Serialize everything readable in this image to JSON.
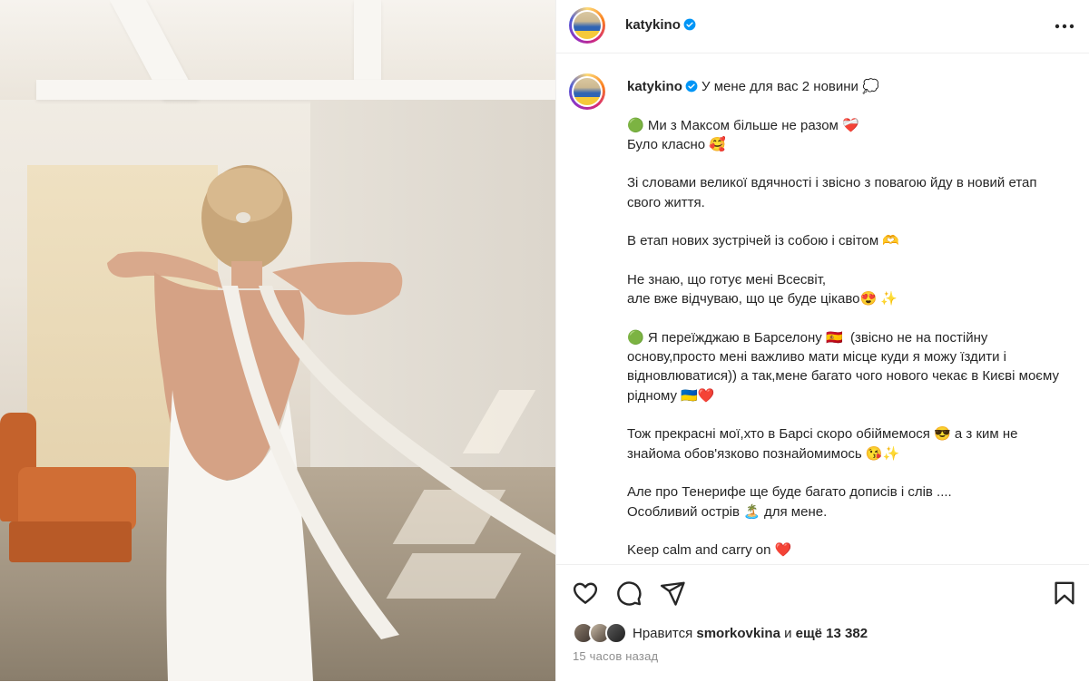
{
  "post": {
    "username": "katykino",
    "caption_lines": [
      "У мене для вас 2 новини 💭",
      "",
      "🟢 Ми з Максом більше не разом ❤️‍🩹",
      "Було класно 🥰",
      "",
      "Зі словами великої вдячності і звісно з повагою йду в новий етап свого життя.",
      "",
      "В етап нових зустрічей із собою і світом 🫶",
      "",
      "Не знаю, що готує мені Всесвіт,",
      "але вже відчуваю, що це буде цікаво😍 ✨",
      "",
      "🟢 Я переїжджаю в Барселону 🇪🇸  (звісно не на постійну основу,просто мені важливо мати місце куди я можу їздити і відновлюватися)) а так,мене багато чого нового чекає в Києві моєму рідному 🇺🇦❤️",
      "",
      "Тож прекрасні мої,хто в Барсі скоро обіймемося 😎 а з ким не знайома обов'язково познайомимось 😘✨",
      "",
      "Але про Тенерифе ще буде багато дописів і слів ....",
      "Особливий острів 🏝️ для мене.",
      "",
      "Keep calm and carry on ❤️"
    ],
    "likes_prefix": "Нравится",
    "liked_by": "smorkovkina",
    "likes_joiner": "и",
    "likes_rest": "ещё 13 382",
    "time_ago": "15 часов назад"
  },
  "icons": {
    "more": "more-horizontal-icon",
    "like": "heart-icon",
    "comment": "comment-icon",
    "share": "send-icon",
    "save": "bookmark-icon",
    "verified": "verified-badge-icon"
  },
  "colors": {
    "verified": "#0095f6",
    "text": "#262626",
    "muted": "#8e8e8e",
    "border": "#efefef"
  }
}
